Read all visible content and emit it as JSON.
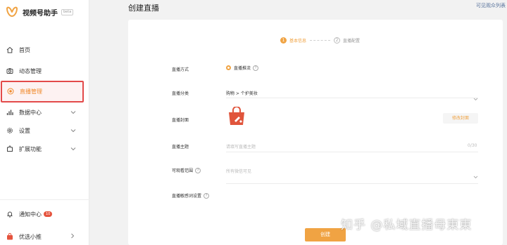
{
  "app": {
    "name": "视频号助手",
    "beta": "beta"
  },
  "sidebar": {
    "items": [
      {
        "label": "首页",
        "icon": "home-icon"
      },
      {
        "label": "动态管理",
        "icon": "camera-icon"
      },
      {
        "label": "直播管理",
        "icon": "live-icon"
      },
      {
        "label": "数据中心",
        "icon": "bar-chart-icon"
      },
      {
        "label": "设置",
        "icon": "gear-icon"
      },
      {
        "label": "扩展功能",
        "icon": "puzzle-icon"
      }
    ],
    "notifications": {
      "label": "通知中心",
      "count": "10"
    },
    "shop": {
      "label": "优选小推"
    }
  },
  "header": {
    "title": "创建直播",
    "link": "可见观众列表"
  },
  "steps": [
    {
      "num": "1",
      "label": "基本信息"
    },
    {
      "num": "2",
      "label": "直播配置"
    }
  ],
  "form": {
    "mode": {
      "label": "直播方式",
      "value": "直播推流"
    },
    "category": {
      "label": "直播分类",
      "value": "购物 > 个护美妆"
    },
    "cover": {
      "label": "直播封面",
      "button": "修改封面"
    },
    "topic": {
      "label": "直播主题",
      "placeholder": "请填写直播主题",
      "counter": "0/30"
    },
    "visibility": {
      "label": "可观看范围",
      "placeholder": "所有微信可见"
    },
    "prohibited": {
      "label": "直播敏感词设置"
    }
  },
  "actions": {
    "create": "创建"
  },
  "watermark": "知乎 @私域直播母東東",
  "colors": {
    "accent": "#f0a343",
    "highlight_border": "#e34a4a",
    "badge": "#e5533d"
  }
}
